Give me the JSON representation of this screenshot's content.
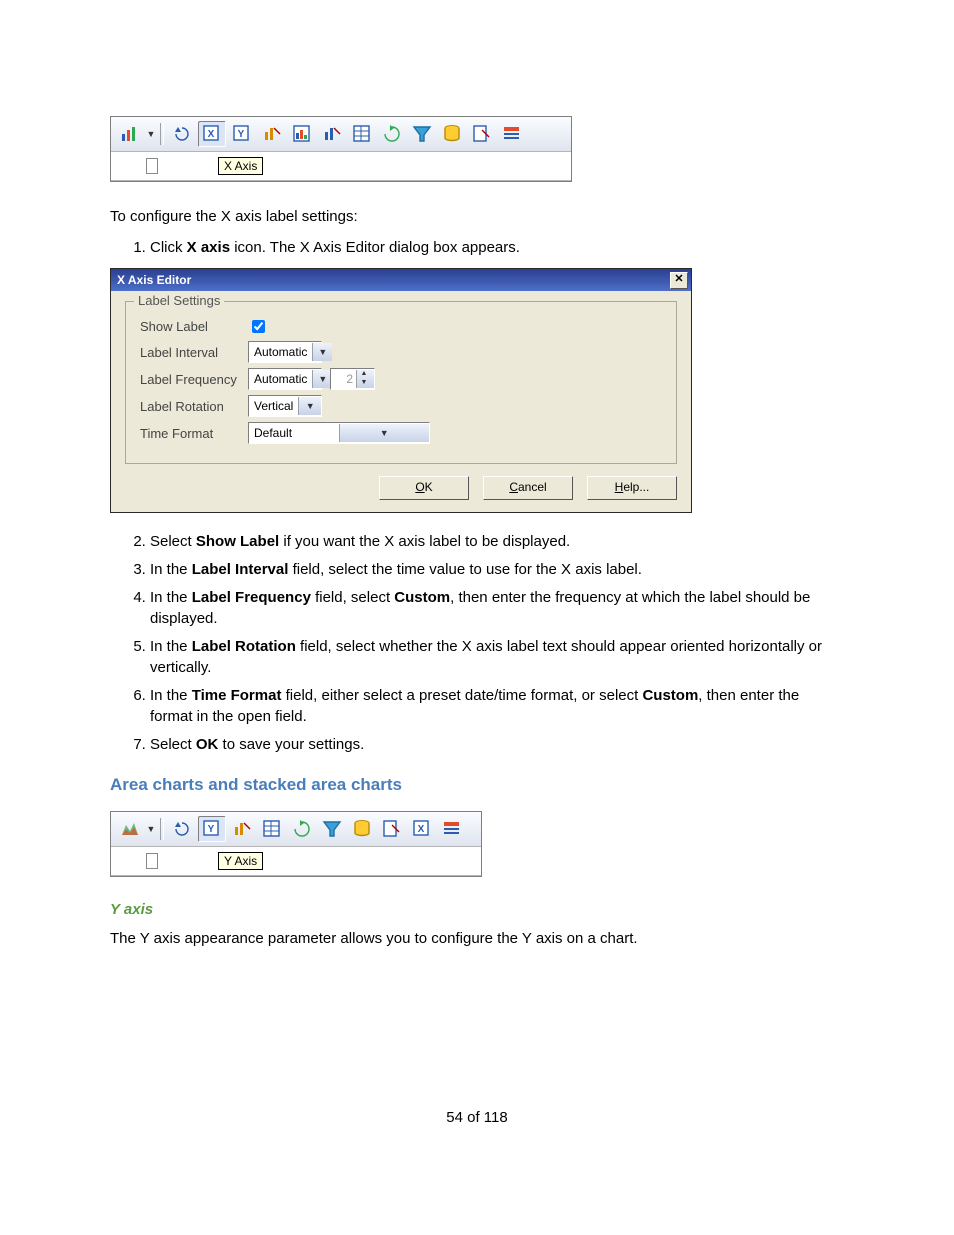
{
  "toolbar1": {
    "tooltip": "X Axis"
  },
  "toolbar2": {
    "tooltip": "Y Axis"
  },
  "p_intro": "To configure the X axis label settings:",
  "steps_a": [
    {
      "n": "1.",
      "pre": "Click ",
      "bold": "X axis",
      "post": " icon. The X Axis Editor dialog box appears."
    }
  ],
  "dialog": {
    "title": "X Axis Editor",
    "legend": "Label Settings",
    "rows": {
      "show_label": {
        "label": "Show Label",
        "checked": true
      },
      "label_interval": {
        "label": "Label Interval",
        "value": "Automatic"
      },
      "label_frequency": {
        "label": "Label Frequency",
        "value": "Automatic",
        "spin": "2"
      },
      "label_rotation": {
        "label": "Label Rotation",
        "value": "Vertical"
      },
      "time_format": {
        "label": "Time Format",
        "value": "Default"
      }
    },
    "buttons": {
      "ok": "OK",
      "cancel": "Cancel",
      "help": "Help..."
    }
  },
  "steps_b": [
    {
      "n": "2.",
      "t1": "Select ",
      "b1": "Show Label",
      "t2": " if you want the X axis label to be displayed."
    },
    {
      "n": "3.",
      "t1": "In the ",
      "b1": "Label Interval",
      "t2": " field, select the time value to use for the X axis label."
    },
    {
      "n": "4.",
      "t1": "In the ",
      "b1": "Label Frequency",
      "t2": " field, select ",
      "b2": "Custom",
      "t3": ", then enter the frequency at which the label should be displayed."
    },
    {
      "n": "5.",
      "t1": "In the ",
      "b1": "Label Rotation",
      "t2": " field, select whether the X axis label text should appear oriented horizontally or vertically."
    },
    {
      "n": "6.",
      "t1": "In the ",
      "b1": "Time Format",
      "t2": " field, either select a preset date/time format, or select ",
      "b2": "Custom",
      "t3": ", then enter the format in the open field."
    },
    {
      "n": "7.",
      "t1": "Select ",
      "b1": "OK",
      "t2": " to save your settings."
    }
  ],
  "heading_area": "Area charts and stacked area charts",
  "heading_yaxis": "Y axis",
  "p_yaxis": "The Y axis appearance parameter allows you to configure the Y axis on a chart.",
  "footer": "54 of 118"
}
